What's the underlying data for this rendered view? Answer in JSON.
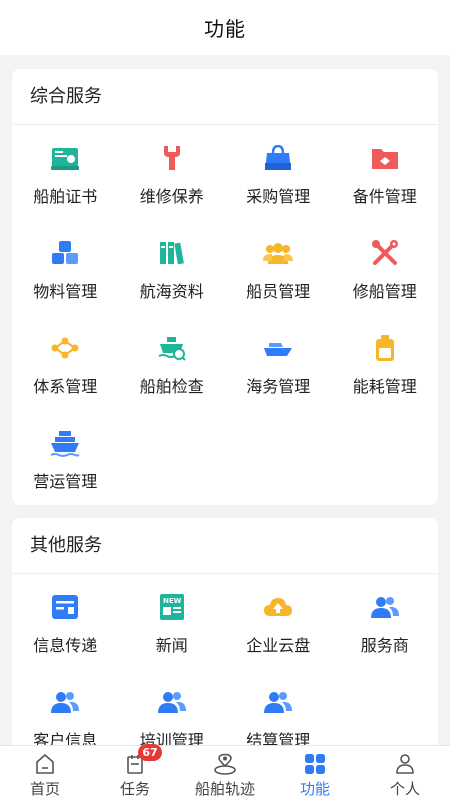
{
  "header": {
    "title": "功能"
  },
  "sections": [
    {
      "title": "综合服务",
      "items": [
        {
          "label": "船舶证书",
          "icon": "certificate-icon"
        },
        {
          "label": "维修保养",
          "icon": "wrench-icon"
        },
        {
          "label": "采购管理",
          "icon": "shopping-bag-icon"
        },
        {
          "label": "备件管理",
          "icon": "folder-icon"
        },
        {
          "label": "物料管理",
          "icon": "boxes-icon"
        },
        {
          "label": "航海资料",
          "icon": "books-icon"
        },
        {
          "label": "船员管理",
          "icon": "crew-icon"
        },
        {
          "label": "修船管理",
          "icon": "tools-icon"
        },
        {
          "label": "体系管理",
          "icon": "network-icon"
        },
        {
          "label": "船舶检查",
          "icon": "ship-inspect-icon"
        },
        {
          "label": "海务管理",
          "icon": "boat-icon"
        },
        {
          "label": "能耗管理",
          "icon": "fuel-can-icon"
        },
        {
          "label": "营运管理",
          "icon": "cargo-ship-icon"
        }
      ]
    },
    {
      "title": "其他服务",
      "items": [
        {
          "label": "信息传递",
          "icon": "message-card-icon"
        },
        {
          "label": "新闻",
          "icon": "news-icon"
        },
        {
          "label": "企业云盘",
          "icon": "cloud-upload-icon"
        },
        {
          "label": "服务商",
          "icon": "users-icon"
        },
        {
          "label": "客户信息",
          "icon": "users-icon"
        },
        {
          "label": "培训管理",
          "icon": "users-icon"
        },
        {
          "label": "结算管理",
          "icon": "users-icon"
        }
      ]
    }
  ],
  "tabbar": {
    "tabs": [
      {
        "label": "首页",
        "icon": "home-icon"
      },
      {
        "label": "任务",
        "icon": "task-icon",
        "badge": "67"
      },
      {
        "label": "船舶轨迹",
        "icon": "location-icon"
      },
      {
        "label": "功能",
        "icon": "grid-icon",
        "active": true
      },
      {
        "label": "个人",
        "icon": "person-icon"
      }
    ]
  },
  "colors": {
    "accent": "#2f7cf6",
    "badge": "#e53935",
    "teal": "#20b59b",
    "red": "#f05a5a",
    "orange": "#f7b529"
  }
}
